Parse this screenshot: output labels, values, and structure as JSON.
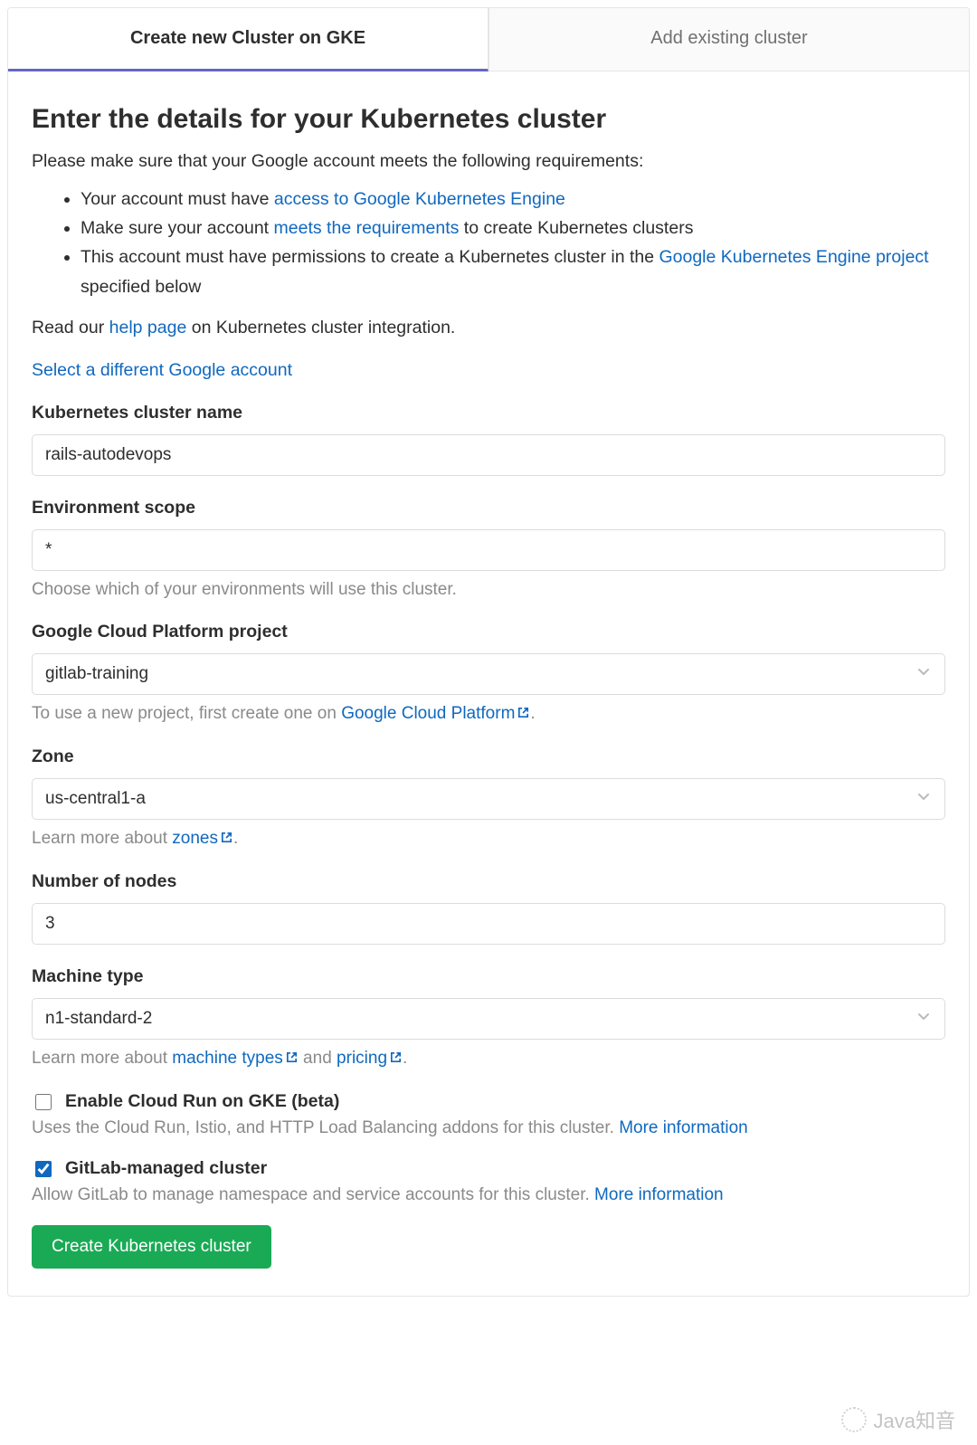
{
  "tabs": {
    "create": "Create new Cluster on GKE",
    "add": "Add existing cluster"
  },
  "heading": "Enter the details for your Kubernetes cluster",
  "intro": "Please make sure that your Google account meets the following requirements:",
  "reqs": {
    "r1_pre": "Your account must have ",
    "r1_link": "access to Google Kubernetes Engine",
    "r2_pre": "Make sure your account ",
    "r2_link": "meets the requirements",
    "r2_post": " to create Kubernetes clusters",
    "r3_pre": "This account must have permissions to create a Kubernetes cluster in the ",
    "r3_link": "Google Kubernetes Engine project",
    "r3_post": " specified below"
  },
  "read": {
    "pre": "Read our ",
    "link": "help page",
    "post": " on Kubernetes cluster integration."
  },
  "select_account": "Select a different Google account",
  "fields": {
    "cluster_name": {
      "label": "Kubernetes cluster name",
      "value": "rails-autodevops"
    },
    "env_scope": {
      "label": "Environment scope",
      "value": "*",
      "help": "Choose which of your environments will use this cluster."
    },
    "gcp_project": {
      "label": "Google Cloud Platform project",
      "value": "gitlab-training",
      "help_pre": "To use a new project, first create one on ",
      "help_link": "Google Cloud Platform",
      "help_post": "."
    },
    "zone": {
      "label": "Zone",
      "value": "us-central1-a",
      "help_pre": "Learn more about ",
      "help_link": "zones",
      "help_post": "."
    },
    "nodes": {
      "label": "Number of nodes",
      "value": "3"
    },
    "machine_type": {
      "label": "Machine type",
      "value": "n1-standard-2",
      "help_pre": "Learn more about ",
      "help_link1": "machine types",
      "help_mid": " and ",
      "help_link2": "pricing",
      "help_post": "."
    }
  },
  "checkboxes": {
    "cloudrun": {
      "label": "Enable Cloud Run on GKE (beta)",
      "checked": false,
      "help": "Uses the Cloud Run, Istio, and HTTP Load Balancing addons for this cluster. ",
      "more": "More information"
    },
    "managed": {
      "label": "GitLab-managed cluster",
      "checked": true,
      "help": "Allow GitLab to manage namespace and service accounts for this cluster. ",
      "more": "More information"
    }
  },
  "submit": "Create Kubernetes cluster",
  "watermark": "Java知音"
}
